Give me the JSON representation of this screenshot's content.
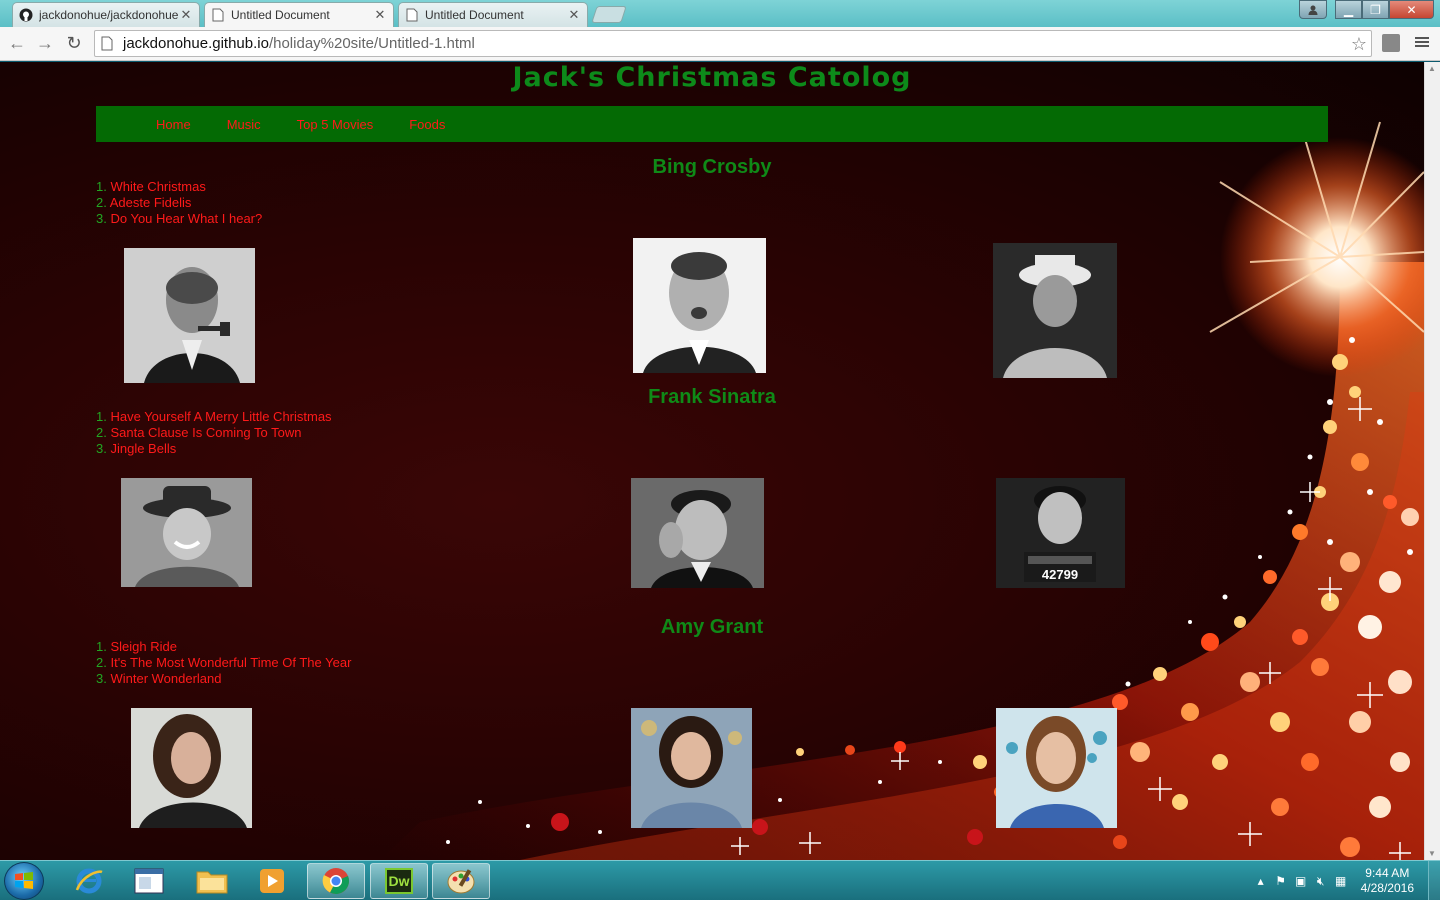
{
  "browser": {
    "tabs": [
      {
        "title": "jackdonohue/jackdonohue",
        "icon": "github-icon",
        "active": false
      },
      {
        "title": "Untitled Document",
        "icon": "page-icon",
        "active": true
      },
      {
        "title": "Untitled Document",
        "icon": "page-icon",
        "active": false
      }
    ],
    "address": {
      "host": "jackdonohue.github.io",
      "path": "/holiday%20site/Untitled-1.html"
    }
  },
  "site": {
    "title": "Jack's Christmas Catolog",
    "nav": [
      "Home",
      "Music",
      "Top 5 Movies",
      "Foods"
    ],
    "artists": [
      {
        "name": "Bing Crosby",
        "songs": [
          "White Christmas",
          "Adeste Fidelis",
          "Do You Hear What I hear?"
        ]
      },
      {
        "name": "Frank Sinatra",
        "songs": [
          "Have Yourself A Merry Little Christmas",
          "Santa Clause Is Coming To Town",
          "Jingle Bells"
        ]
      },
      {
        "name": "Amy Grant",
        "songs": [
          "Sleigh Ride",
          "It's The Most Wonderful Time Of The Year",
          "Winter Wonderland"
        ]
      }
    ],
    "mugshot_text": "42799",
    "colors": {
      "title_green": "#0d8a1a",
      "nav_bg": "#046a04",
      "link_red": "#ff1a1a"
    }
  },
  "taskbar": {
    "time": "9:44 AM",
    "date": "4/28/2016",
    "apps": [
      "internet-explorer-icon",
      "window-icon",
      "file-explorer-icon",
      "media-player-icon",
      "chrome-icon",
      "dreamweaver-icon",
      "paint-icon"
    ],
    "dreamweaver_label": "Dw"
  }
}
